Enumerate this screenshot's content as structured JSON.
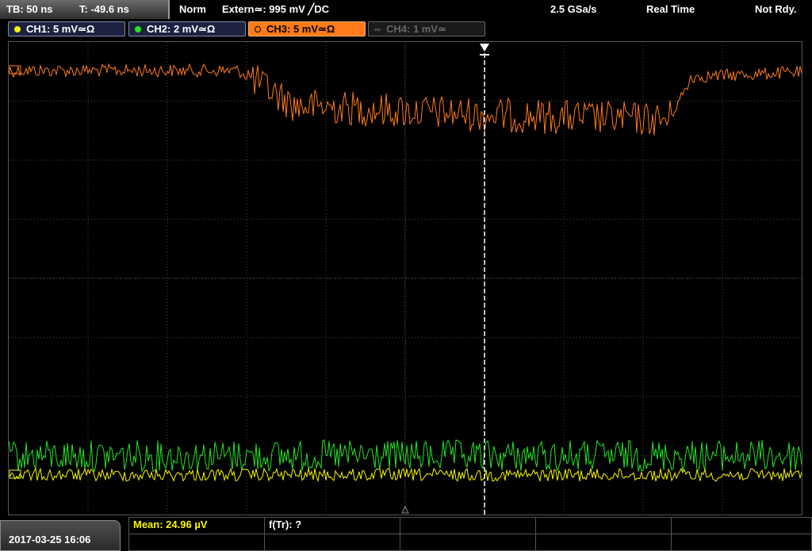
{
  "header": {
    "timebase": "TB: 50 ns",
    "trigger_time": "T: -49.6 ns",
    "trigger_mode": "Norm",
    "trigger_source": "Extern≃: 995 mV ╱DC",
    "sample_rate": "2.5 GSa/s",
    "acq_mode": "Real Time",
    "status": "Not Rdy."
  },
  "channels": [
    {
      "label": "CH1: 5 mV≃Ω",
      "color": "#f7f700",
      "active": true
    },
    {
      "label": "CH2: 2 mV≃Ω",
      "color": "#22e622",
      "active": true
    },
    {
      "label": "CH3: 5 mV≃Ω",
      "color": "#ff7a1a",
      "active": true,
      "selected": true
    },
    {
      "label": "CH4: 1 mV≃",
      "color": "#666666",
      "active": false
    }
  ],
  "footer": {
    "datetime": "2017-03-25 16:06",
    "measurement_1": "Mean: 24.96 µV",
    "measurement_2": "f(Tr): ?"
  },
  "colors": {
    "ch1": "#f7f700",
    "ch2": "#22e622",
    "ch3": "#ff7a1a",
    "grid": "#444444",
    "trigger_line": "#ffffff"
  },
  "icons": {
    "trigger_marker": "trigger-arrow-icon",
    "ground_marker": "ground-arrow-icon"
  }
}
